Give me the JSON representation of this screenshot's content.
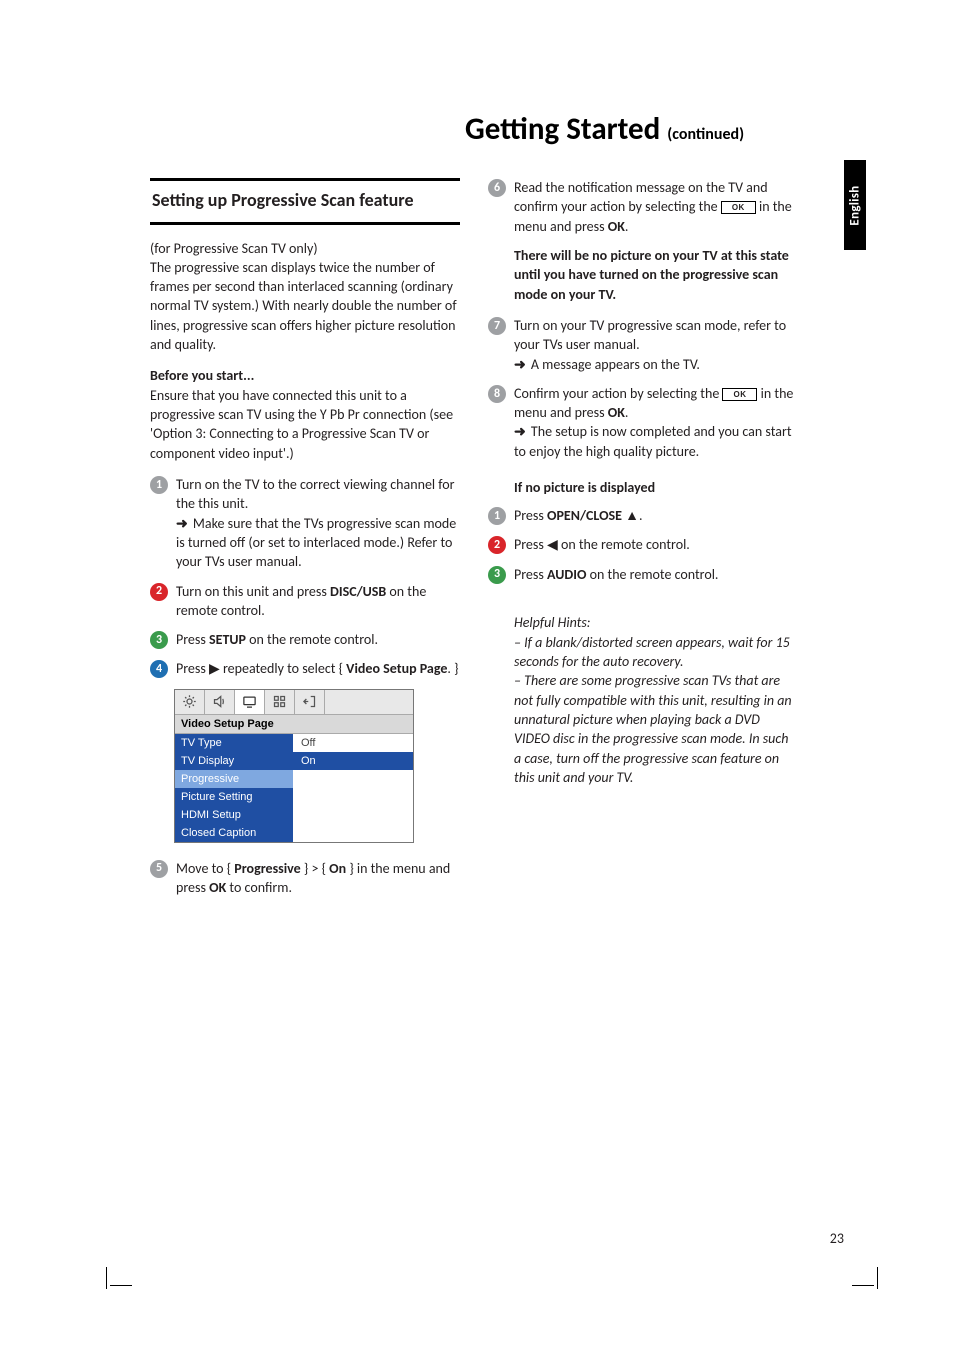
{
  "language_tab": "English",
  "title": "Getting Started",
  "title_suffix": "(continued)",
  "page_number": "23",
  "left": {
    "section_heading": "Setting up Progressive Scan feature",
    "intro": "(for Progressive Scan TV only)\nThe progressive scan displays twice the number of frames per second than interlaced scanning (ordinary normal TV system.) With nearly double the number of lines, progressive scan offers higher picture resolution and quality.",
    "before_heading": "Before you start...",
    "before_body": "Ensure that you have connected this unit to a progressive scan TV using the Y Pb Pr connection (see 'Option 3: Connecting to a Progressive Scan TV or component video input'.)",
    "step1_a": "Turn on the TV to the correct viewing channel for the this unit.",
    "step1_b": "Make sure that the TVs progressive scan mode is turned off (or set to interlaced mode.) Refer to your TVs user manual.",
    "step2_a": "Turn on this unit and press ",
    "step2_b": "DISC/USB",
    "step2_c": " on the remote control.",
    "step3_a": "Press ",
    "step3_b": "SETUP",
    "step3_c": " on the remote control.",
    "step4_a": "Press ",
    "step4_b": " repeatedly to select { ",
    "step4_c": "Video Setup Page",
    "step4_d": ". }",
    "step5_a": "Move to { ",
    "step5_b": "Progressive",
    "step5_c": " } > { ",
    "step5_d": "On",
    "step5_e": " } in the menu and press ",
    "step5_f": "OK",
    "step5_g": " to confirm."
  },
  "menu": {
    "heading": "Video Setup Page",
    "left_items": [
      "TV Type",
      "TV Display",
      "Progressive",
      "Picture Setting",
      "HDMI Setup",
      "Closed Caption"
    ],
    "right_items": [
      "Off",
      "On"
    ]
  },
  "right": {
    "step6_a": "Read the notification message on the TV and confirm your action by selecting the ",
    "step6_b": " in the menu and press ",
    "step6_c": "OK",
    "step6_d": ".",
    "callout": "There will be no picture on your TV at this state until you have turned on the progressive scan mode on your TV.",
    "step7_a": "Turn on your TV progressive scan mode, refer to your TVs user manual.",
    "step7_b": "A message appears on the TV.",
    "step8_a": "Confirm your action by selecting the ",
    "step8_b": " in the menu and press ",
    "step8_c": "OK",
    "step8_d": ".",
    "step8_e": "The setup is now completed and you can start to enjoy the high quality picture.",
    "sub_heading": "If no picture is displayed",
    "r1_a": "Press ",
    "r1_b": "OPEN/CLOSE",
    "r1_c": " ",
    "r1_d": ".",
    "r2_a": "Press ",
    "r2_b": " on the remote control.",
    "r3_a": "Press ",
    "r3_b": "AUDIO",
    "r3_c": " on the remote control.",
    "hints_heading": "Helpful Hints:",
    "hints_body": "– If a blank/distorted screen appears, wait for 15 seconds for the auto recovery.\n– There are some progressive scan TVs that are not fully compatible with this unit, resulting in an unnatural picture when playing back a DVD VIDEO disc in the progressive scan mode. In such a case, turn off the progressive scan feature on this unit and your TV."
  },
  "ok_label": "OK"
}
